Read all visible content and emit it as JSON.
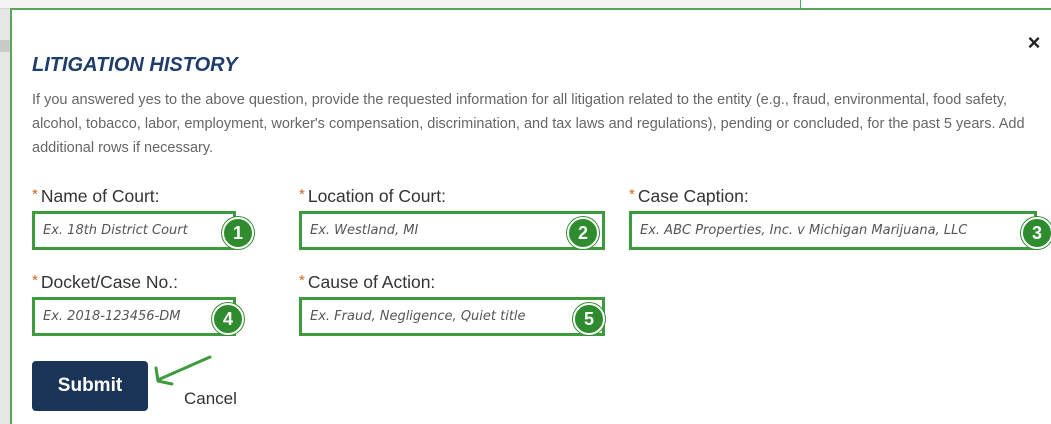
{
  "dialog": {
    "title": "LITIGATION HISTORY",
    "description": "If you answered yes to the above question, provide the requested information for all litigation related to the entity (e.g., fraud, environmental, food safety, alcohol, tobacco, labor, employment, worker's compensation, discrimination, and tax laws and regulations), pending or concluded, for the past 5 years. Add additional rows if necessary.",
    "close_label": "×",
    "required_marker": "*"
  },
  "fields": [
    {
      "label": "Name of Court:",
      "placeholder": "Ex. 18th District Court",
      "badge": "1"
    },
    {
      "label": "Location of Court:",
      "placeholder": "Ex. Westland, MI",
      "badge": "2"
    },
    {
      "label": "Case Caption:",
      "placeholder": "Ex. ABC Properties, Inc. v Michigan Marijuana, LLC",
      "badge": "3"
    },
    {
      "label": "Docket/Case No.:",
      "placeholder": "Ex. 2018-123456-DM",
      "badge": "4"
    },
    {
      "label": "Cause of Action:",
      "placeholder": "Ex. Fraud, Negligence, Quiet title",
      "badge": "5"
    }
  ],
  "actions": {
    "submit_label": "Submit",
    "cancel_label": "Cancel"
  },
  "colors": {
    "title": "#1e3d6b",
    "highlight": "#3d9a3d",
    "submit_bg": "#1b3558",
    "required": "#d4651c"
  }
}
